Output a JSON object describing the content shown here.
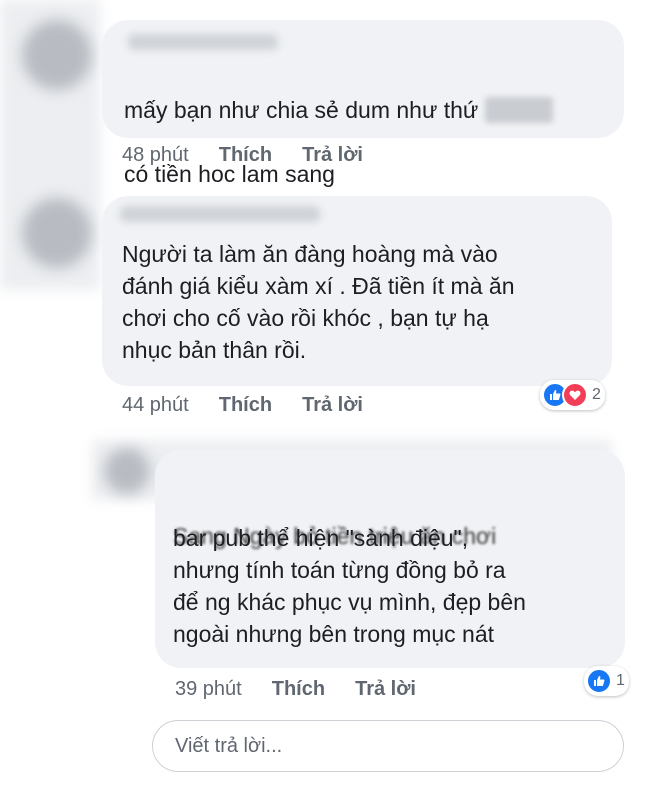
{
  "comments": [
    {
      "text_line1": "mấy bạn như chia sẻ dum như thứ",
      "text_line2": "có tiền hoc lam sang",
      "time": "48 phút",
      "like_label": "Thích",
      "reply_label": "Trả lời",
      "reaction_count": null
    },
    {
      "text": "Người ta làm ăn đàng hoàng  mà vào\nđánh giá kiểu xàm xí . Đã tiền ít mà ăn\nchơi cho cố vào rồi khóc , bạn tự hạ\nnhục bản thân rồi.",
      "time": "44 phút",
      "like_label": "Thích",
      "reply_label": "Trả lời",
      "reaction_count": "2",
      "reactions": [
        "like-icon",
        "love-icon"
      ]
    },
    {
      "text": "bar pub thể hiện \"sành điệu\",\nnhưng tính toán từng đồng bỏ ra\nđể ng khác phục vụ mình, đẹp bên\nngoài nhưng bên trong mục nát",
      "partial_line": "Sang Ngày   bỏ tiền triệu ăn chơi",
      "time": "39 phút",
      "like_label": "Thích",
      "reply_label": "Trả lời",
      "reaction_count": "1",
      "reactions": [
        "like-icon"
      ]
    }
  ],
  "reply_input": {
    "placeholder": "Viết trả lời..."
  },
  "colors": {
    "bubble": "#f0f2f5",
    "meta_text": "#606770",
    "like_blue": "#1877f2",
    "love_red": "#f33e58"
  }
}
